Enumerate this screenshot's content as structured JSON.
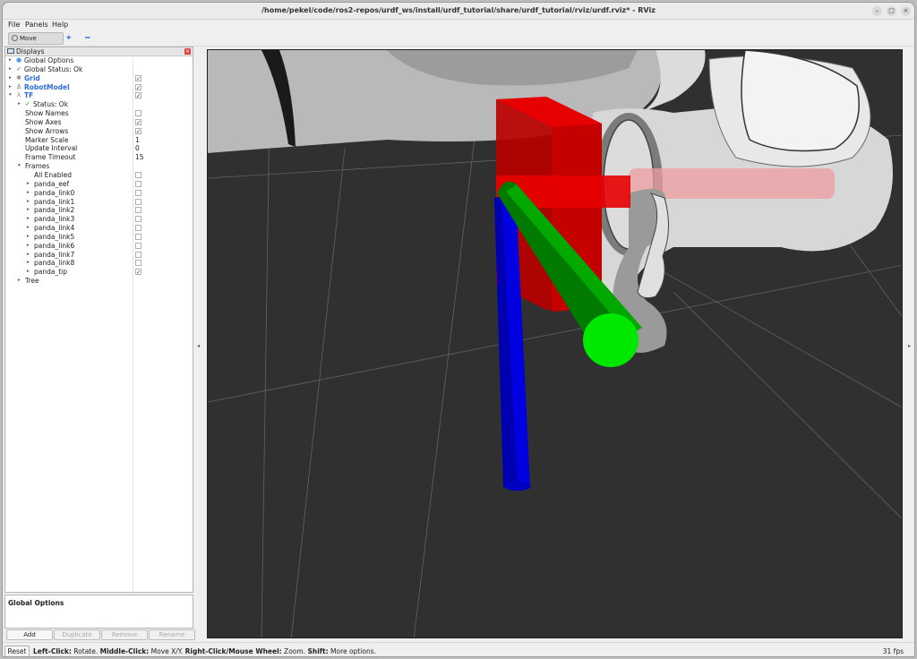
{
  "window": {
    "title": "/home/pekel/code/ros2-repos/urdf_ws/install/urdf_tutorial/share/urdf_tutorial/rviz/urdf.rviz* - RViz",
    "minimize_glyph": "–",
    "maximize_glyph": "□",
    "close_glyph": "×"
  },
  "menu": [
    "File",
    "Panels",
    "Help"
  ],
  "toolbar": {
    "move_camera": "Move Camera",
    "icons": [
      "focus-camera-icon",
      "measure-icon"
    ]
  },
  "displays": {
    "title": "Displays",
    "rows": [
      {
        "label": "Global Options",
        "icon": "●",
        "icon_color": "#5aa0e0"
      },
      {
        "label": "Global Status: Ok",
        "icon": "✓",
        "icon_color": "#2a8a2a"
      },
      {
        "label": "Grid",
        "icon": "✱",
        "icon_color": "#888888",
        "checked": "✓"
      },
      {
        "label": "RobotModel",
        "icon": "♙",
        "icon_color": "#555555",
        "checked": "✓"
      },
      {
        "label": "TF",
        "icon": "⅄",
        "icon_color": "#777777",
        "checked": "✓"
      },
      {
        "label": "Status: Ok",
        "icon": "✓",
        "icon_color": "#2a8a2a"
      },
      {
        "label": "Show Names",
        "checked": ""
      },
      {
        "label": "Show Axes",
        "checked": "✓"
      },
      {
        "label": "Show Arrows",
        "checked": "✓"
      },
      {
        "label": "Marker Scale",
        "value": "1"
      },
      {
        "label": "Update Interval",
        "value": "0"
      },
      {
        "label": "Frame Timeout",
        "value": "15"
      },
      {
        "label": "Frames"
      },
      {
        "label": "All Enabled",
        "checked": ""
      },
      {
        "label": "panda_eef",
        "checked": ""
      },
      {
        "label": "panda_link0",
        "checked": ""
      },
      {
        "label": "panda_link1",
        "checked": ""
      },
      {
        "label": "panda_link2",
        "checked": ""
      },
      {
        "label": "panda_link3",
        "checked": ""
      },
      {
        "label": "panda_link4",
        "checked": ""
      },
      {
        "label": "panda_link5",
        "checked": ""
      },
      {
        "label": "panda_link6",
        "checked": ""
      },
      {
        "label": "panda_link7",
        "checked": ""
      },
      {
        "label": "panda_link8",
        "checked": ""
      },
      {
        "label": "panda_tip",
        "checked": "✓"
      },
      {
        "label": "Tree"
      }
    ]
  },
  "description": {
    "title": "Global Options"
  },
  "buttons": {
    "add": "Add",
    "duplicate": "Duplicate",
    "remove": "Remove",
    "rename": "Rename"
  },
  "status": {
    "reset": "Reset",
    "hint_parts": [
      {
        "bold": "Left-Click:",
        "text": " Rotate. "
      },
      {
        "bold": "Middle-Click:",
        "text": " Move X/Y. "
      },
      {
        "bold": "Right-Click/Mouse Wheel:",
        "text": " Zoom. "
      },
      {
        "bold": "Shift:",
        "text": " More options."
      }
    ],
    "fps": "31 fps"
  },
  "scene": {
    "background": "#303030",
    "grid_color": "#6a6a6a",
    "x_axis_color": "#e80000",
    "y_axis_color": "#00b000",
    "z_axis_color": "#0000e0"
  }
}
